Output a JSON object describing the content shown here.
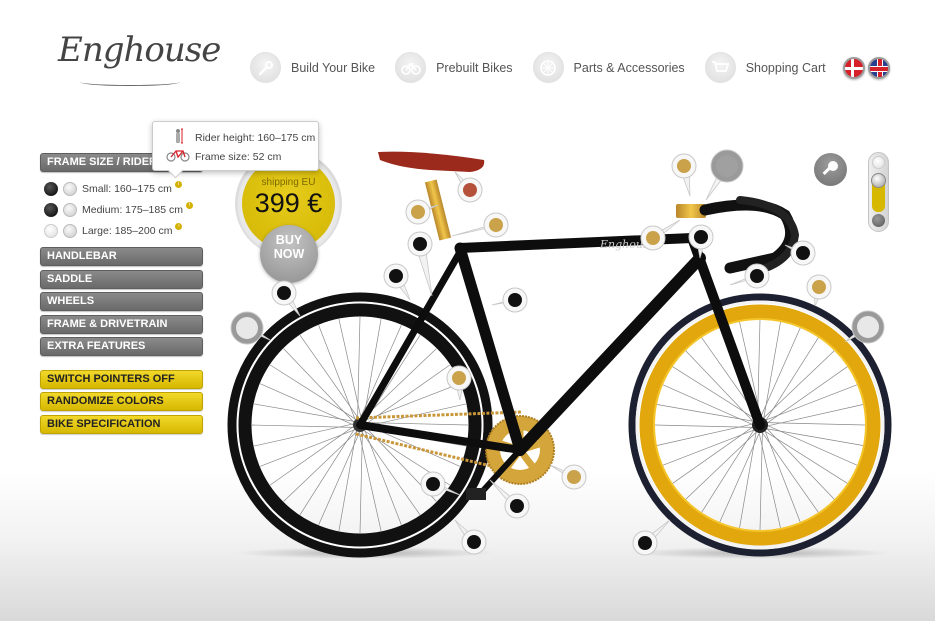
{
  "brand": {
    "logo_text": "Enghouse"
  },
  "nav": {
    "items": [
      {
        "label": "Build Your Bike",
        "icon": "wrench-icon",
        "glyph": "🔧"
      },
      {
        "label": "Prebuilt Bikes",
        "icon": "bicycle-icon",
        "glyph": "🚲"
      },
      {
        "label": "Parts & Accessories",
        "icon": "wheel-icon",
        "glyph": "⊛"
      },
      {
        "label": "Shopping Cart",
        "icon": "cart-icon",
        "glyph": "🛒"
      }
    ],
    "languages": [
      {
        "name": "Danish",
        "icon": "flag-denmark-icon"
      },
      {
        "name": "English",
        "icon": "flag-uk-icon"
      }
    ]
  },
  "panel": {
    "frame_size_label": "Frame Size / Rider Height",
    "sizes": [
      {
        "label": "Small: 160–175 cm",
        "color": "black",
        "info": "i"
      },
      {
        "label": "Medium: 175–185 cm",
        "color": "black",
        "info": "i"
      },
      {
        "label": "Large: 185–200 cm",
        "color": "white",
        "info": "i"
      }
    ],
    "sections": [
      "Handlebar",
      "Saddle",
      "Wheels",
      "Frame & Drivetrain",
      "Extra Features"
    ],
    "actions": [
      "Switch Pointers Off",
      "Randomize Colors",
      "Bike Specification"
    ]
  },
  "tooltip": {
    "rider_height": "Rider height: 160–175 cm",
    "frame_size": "Frame size: 52 cm"
  },
  "price": {
    "shipping_label": "shipping EU",
    "value": "399 €",
    "buy_label_1": "BUY",
    "buy_label_2": "NOW"
  },
  "tools": {
    "zoom": "zoom-icon",
    "slider_position": "middle"
  },
  "colors": {
    "accent_yellow": "#d6b800",
    "button_gray": "#767676",
    "frame_black": "#111111",
    "gold": "#c9a24a",
    "saddle_red": "#9b2a1c",
    "rim_gold": "#e0a80e"
  },
  "bike": {
    "frame_logo": "Enghouse",
    "pins": [
      {
        "part": "saddle",
        "color": "#b5513a"
      },
      {
        "part": "seatpost",
        "color": "#c9a24a"
      },
      {
        "part": "seat-clamp",
        "color": "#c9a24a"
      },
      {
        "part": "rear-brake-cable",
        "color": "#111111"
      },
      {
        "part": "rear-brake",
        "color": "#111111"
      },
      {
        "part": "rear-tire",
        "color": "#111111"
      },
      {
        "part": "rear-rim",
        "color": "hub"
      },
      {
        "part": "seat-tube",
        "color": "#111111"
      },
      {
        "part": "chain",
        "color": "#c9a24a"
      },
      {
        "part": "stem",
        "color": "#c9a24a"
      },
      {
        "part": "headset",
        "color": "#c9a24a"
      },
      {
        "part": "bar-tape",
        "color": "#111111"
      },
      {
        "part": "handlebar",
        "color": "bars"
      },
      {
        "part": "brake-lever",
        "color": "#111111"
      },
      {
        "part": "front-brake",
        "color": "#111111"
      },
      {
        "part": "front-rim",
        "color": "#c9a24a"
      },
      {
        "part": "front-hub",
        "color": "hub"
      },
      {
        "part": "chainring",
        "color": "#c9a24a"
      },
      {
        "part": "crank",
        "color": "#111111"
      },
      {
        "part": "pedal",
        "color": "#111111"
      },
      {
        "part": "rear-wheel-bottom",
        "color": "#111111"
      },
      {
        "part": "front-tire",
        "color": "#111111"
      }
    ]
  }
}
